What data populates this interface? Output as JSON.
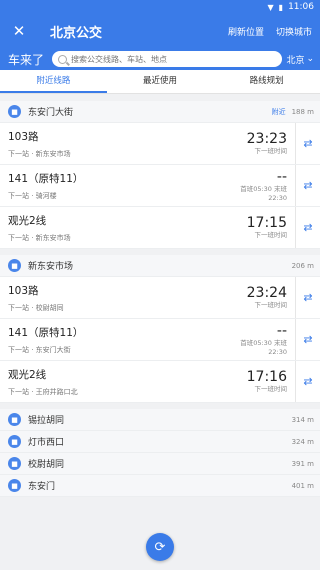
{
  "status": {
    "time": "11:06"
  },
  "header": {
    "title": "北京公交",
    "refresh_label": "刷新位置",
    "switch_city_label": "切换城市"
  },
  "search": {
    "brand": "车来了",
    "placeholder": "搜索公交线路、车站、地点",
    "city": "北京"
  },
  "tabs": [
    {
      "label": "附近线路",
      "active": true
    },
    {
      "label": "最近使用",
      "active": false
    },
    {
      "label": "路线规划",
      "active": false
    }
  ],
  "stops": [
    {
      "name": "东安门大街",
      "tag": "附近",
      "distance": "188 m",
      "routes": [
        {
          "name": "103路",
          "next": "下一站 · 新东安市场",
          "time": "23:23",
          "sub1": "下一班时间",
          "sub2": ""
        },
        {
          "name": "141（原特11）",
          "next": "下一站 · 骑河楼",
          "time": "--",
          "sub1": "首班05:30 末班",
          "sub2": "22:30"
        },
        {
          "name": "观光2线",
          "next": "下一站 · 新东安市场",
          "time": "17:15",
          "sub1": "下一班时间",
          "sub2": ""
        }
      ]
    },
    {
      "name": "新东安市场",
      "tag": "",
      "distance": "206 m",
      "routes": [
        {
          "name": "103路",
          "next": "下一站 · 校尉胡同",
          "time": "23:24",
          "sub1": "下一班时间",
          "sub2": ""
        },
        {
          "name": "141（原特11）",
          "next": "下一站 · 东安门大街",
          "time": "--",
          "sub1": "首班05:30 末班",
          "sub2": "22:30"
        },
        {
          "name": "观光2线",
          "next": "下一站 · 王府井路口北",
          "time": "17:16",
          "sub1": "下一班时间",
          "sub2": ""
        }
      ]
    }
  ],
  "other_stops": [
    {
      "name": "锡拉胡同",
      "distance": "314 m"
    },
    {
      "name": "灯市西口",
      "distance": "324 m"
    },
    {
      "name": "校尉胡同",
      "distance": "391 m"
    },
    {
      "name": "东安门",
      "distance": "401 m"
    }
  ],
  "colors": {
    "primary": "#3a7be8"
  },
  "icons": {
    "bus": "bus-icon",
    "swap": "swap-icon",
    "refresh": "refresh-icon",
    "close": "close-icon"
  }
}
